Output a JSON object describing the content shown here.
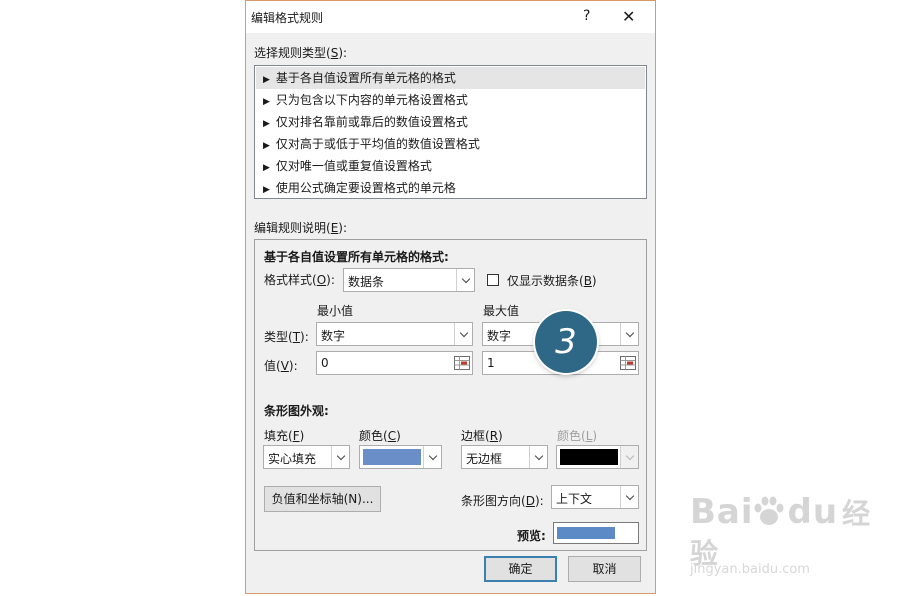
{
  "dialog": {
    "title": "编辑格式规则",
    "help": "?",
    "close": "✕"
  },
  "rule_type": {
    "label": "选择规则类型(",
    "key": "S",
    "label_end": "):",
    "items": [
      "基于各自值设置所有单元格的格式",
      "只为包含以下内容的单元格设置格式",
      "仅对排名靠前或靠后的数值设置格式",
      "仅对高于或低于平均值的数值设置格式",
      "仅对唯一值或重复值设置格式",
      "使用公式确定要设置格式的单元格"
    ],
    "selected_index": 0
  },
  "description": {
    "label": "编辑规则说明(",
    "key": "E",
    "label_end": "):",
    "heading": "基于各自值设置所有单元格的格式:",
    "format_style": {
      "label": "格式样式(",
      "key": "O",
      "label_end": "):",
      "value": "数据条"
    },
    "bar_only": {
      "label": "仅显示数据条(",
      "key": "B",
      "label_end": ")",
      "checked": false
    },
    "min_header": "最小值",
    "max_header": "最大值",
    "type_label": {
      "label": "类型(",
      "key": "T",
      "label_end": "):"
    },
    "value_label": {
      "label": "值(",
      "key": "V",
      "label_end": "):"
    },
    "min_type": "数字",
    "max_type": "数字",
    "min_value": "0",
    "max_value": "1"
  },
  "bar_appearance": {
    "heading": "条形图外观:",
    "fill": {
      "label": "填充(",
      "key": "F",
      "label_end": ")",
      "value": "实心填充"
    },
    "fill_color": {
      "label": "颜色(",
      "key": "C",
      "label_end": ")",
      "color": "#6a8fc8"
    },
    "border": {
      "label": "边框(",
      "key": "R",
      "label_end": ")",
      "value": "无边框"
    },
    "border_color": {
      "label": "颜色(",
      "key": "L",
      "label_end": ")",
      "color": "#000000"
    },
    "negative_button": {
      "label": "负值和坐标轴(",
      "key": "N",
      "label_end": ")..."
    },
    "direction": {
      "label": "条形图方向(",
      "key": "D",
      "label_end": "):",
      "value": "上下文"
    },
    "preview_label": "预览:",
    "preview_color": "#5b8ac6"
  },
  "buttons": {
    "ok": "确定",
    "cancel": "取消"
  },
  "callout": "3",
  "watermark": {
    "text_a": "Bai",
    "text_b": "du",
    "text_c": "经验",
    "url": "jingyan.baidu.com"
  }
}
